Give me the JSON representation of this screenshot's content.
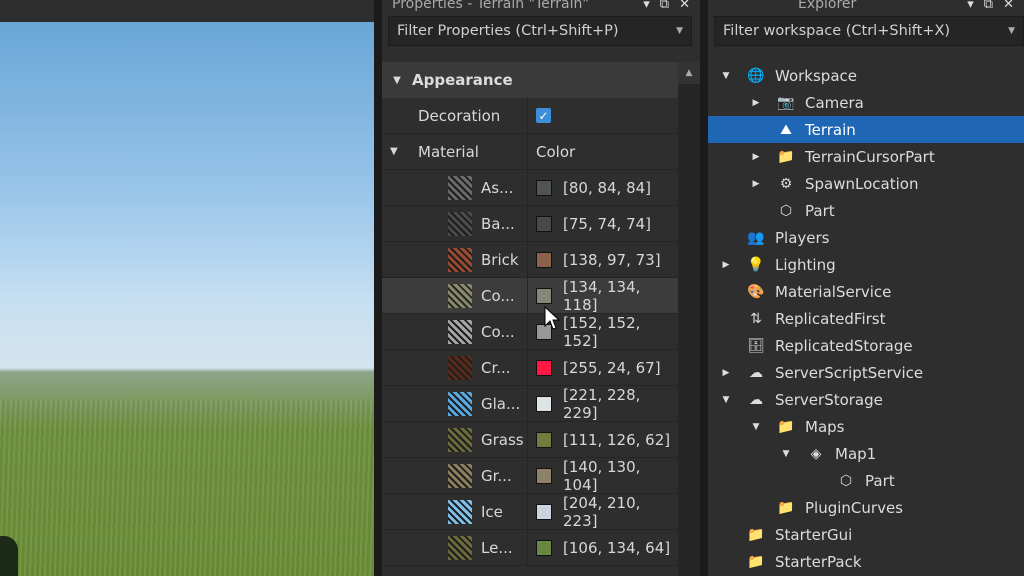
{
  "properties": {
    "title": "Properties - Terrain \"Terrain\"",
    "filter_placeholder": "Filter Properties (Ctrl+Shift+P)",
    "section": "Appearance",
    "decoration_label": "Decoration",
    "material_label": "Material",
    "color_header": "Color",
    "materials": [
      {
        "name": "As...",
        "color_text": "[80, 84, 84]",
        "color": "#505454",
        "tex": "#6a6a6a"
      },
      {
        "name": "Ba...",
        "color_text": "[75, 74, 74]",
        "color": "#4b4a4a",
        "tex": "#4a4a4a"
      },
      {
        "name": "Brick",
        "color_text": "[138, 97, 73]",
        "color": "#8a6149",
        "tex": "#9a4a33"
      },
      {
        "name": "Co...",
        "color_text": "[134, 134, 118]",
        "color": "#868676",
        "tex": "#8a8a6a"
      },
      {
        "name": "Co...",
        "color_text": "[152, 152, 152]",
        "color": "#989898",
        "tex": "#a5a5a5"
      },
      {
        "name": "Cr...",
        "color_text": "[255, 24, 67]",
        "color": "#ff1843",
        "tex": "#5a2a18"
      },
      {
        "name": "Gla...",
        "color_text": "[221, 228, 229]",
        "color": "#dde4e5",
        "tex": "#5aa8e0"
      },
      {
        "name": "Grass",
        "color_text": "[111, 126, 62]",
        "color": "#6f7e3e",
        "tex": "#6a6b3a"
      },
      {
        "name": "Gr...",
        "color_text": "[140, 130, 104]",
        "color": "#8c8268",
        "tex": "#8a7f5a"
      },
      {
        "name": "Ice",
        "color_text": "[204, 210, 223]",
        "color": "#ccd2df",
        "tex": "#7fc0ea"
      },
      {
        "name": "Le...",
        "color_text": "[106, 134, 64]",
        "color": "#6a8640",
        "tex": "#6a6a3a"
      }
    ]
  },
  "explorer": {
    "title": "Explorer",
    "filter_placeholder": "Filter workspace (Ctrl+Shift+X)",
    "items": [
      {
        "label": "Workspace",
        "icon": "globe-icon",
        "glyph": "🌐",
        "indent": 0,
        "expander": "▼"
      },
      {
        "label": "Camera",
        "icon": "camera-icon",
        "glyph": "📷",
        "indent": 1,
        "expander": "▶"
      },
      {
        "label": "Terrain",
        "icon": "terrain-icon",
        "glyph": "⛰",
        "indent": 1,
        "expander": "",
        "selected": true
      },
      {
        "label": "TerrainCursorPart",
        "icon": "folder-icon",
        "glyph": "📁",
        "indent": 1,
        "expander": "▶"
      },
      {
        "label": "SpawnLocation",
        "icon": "gear-icon",
        "glyph": "⚙",
        "indent": 1,
        "expander": "▶"
      },
      {
        "label": "Part",
        "icon": "cube-icon",
        "glyph": "⬡",
        "indent": 1,
        "expander": ""
      },
      {
        "label": "Players",
        "icon": "players-icon",
        "glyph": "👥",
        "indent": 0,
        "expander": ""
      },
      {
        "label": "Lighting",
        "icon": "lightbulb-icon",
        "glyph": "💡",
        "indent": 0,
        "expander": "▶"
      },
      {
        "label": "MaterialService",
        "icon": "material-service-icon",
        "glyph": "🎨",
        "indent": 0,
        "expander": ""
      },
      {
        "label": "ReplicatedFirst",
        "icon": "replicated-first-icon",
        "glyph": "⇅",
        "indent": 0,
        "expander": ""
      },
      {
        "label": "ReplicatedStorage",
        "icon": "replicated-storage-icon",
        "glyph": "🗄",
        "indent": 0,
        "expander": ""
      },
      {
        "label": "ServerScriptService",
        "icon": "server-script-service-icon",
        "glyph": "☁",
        "indent": 0,
        "expander": "▶"
      },
      {
        "label": "ServerStorage",
        "icon": "server-storage-icon",
        "glyph": "☁",
        "indent": 0,
        "expander": "▼"
      },
      {
        "label": "Maps",
        "icon": "folder-icon",
        "glyph": "📁",
        "indent": 1,
        "expander": "▼"
      },
      {
        "label": "Map1",
        "icon": "model-icon",
        "glyph": "◈",
        "indent": 2,
        "expander": "▼"
      },
      {
        "label": "Part",
        "icon": "cube-icon",
        "glyph": "⬡",
        "indent": 3,
        "expander": ""
      },
      {
        "label": "PluginCurves",
        "icon": "folder-icon",
        "glyph": "📁",
        "indent": 1,
        "expander": ""
      },
      {
        "label": "StarterGui",
        "icon": "starter-gui-icon",
        "glyph": "📁",
        "indent": 0,
        "expander": ""
      },
      {
        "label": "StarterPack",
        "icon": "starter-pack-icon",
        "glyph": "📁",
        "indent": 0,
        "expander": ""
      }
    ]
  },
  "colors": {
    "selection": "#1f66b4",
    "checkbox": "#3d8fd8",
    "panel": "#2e2e2e"
  }
}
